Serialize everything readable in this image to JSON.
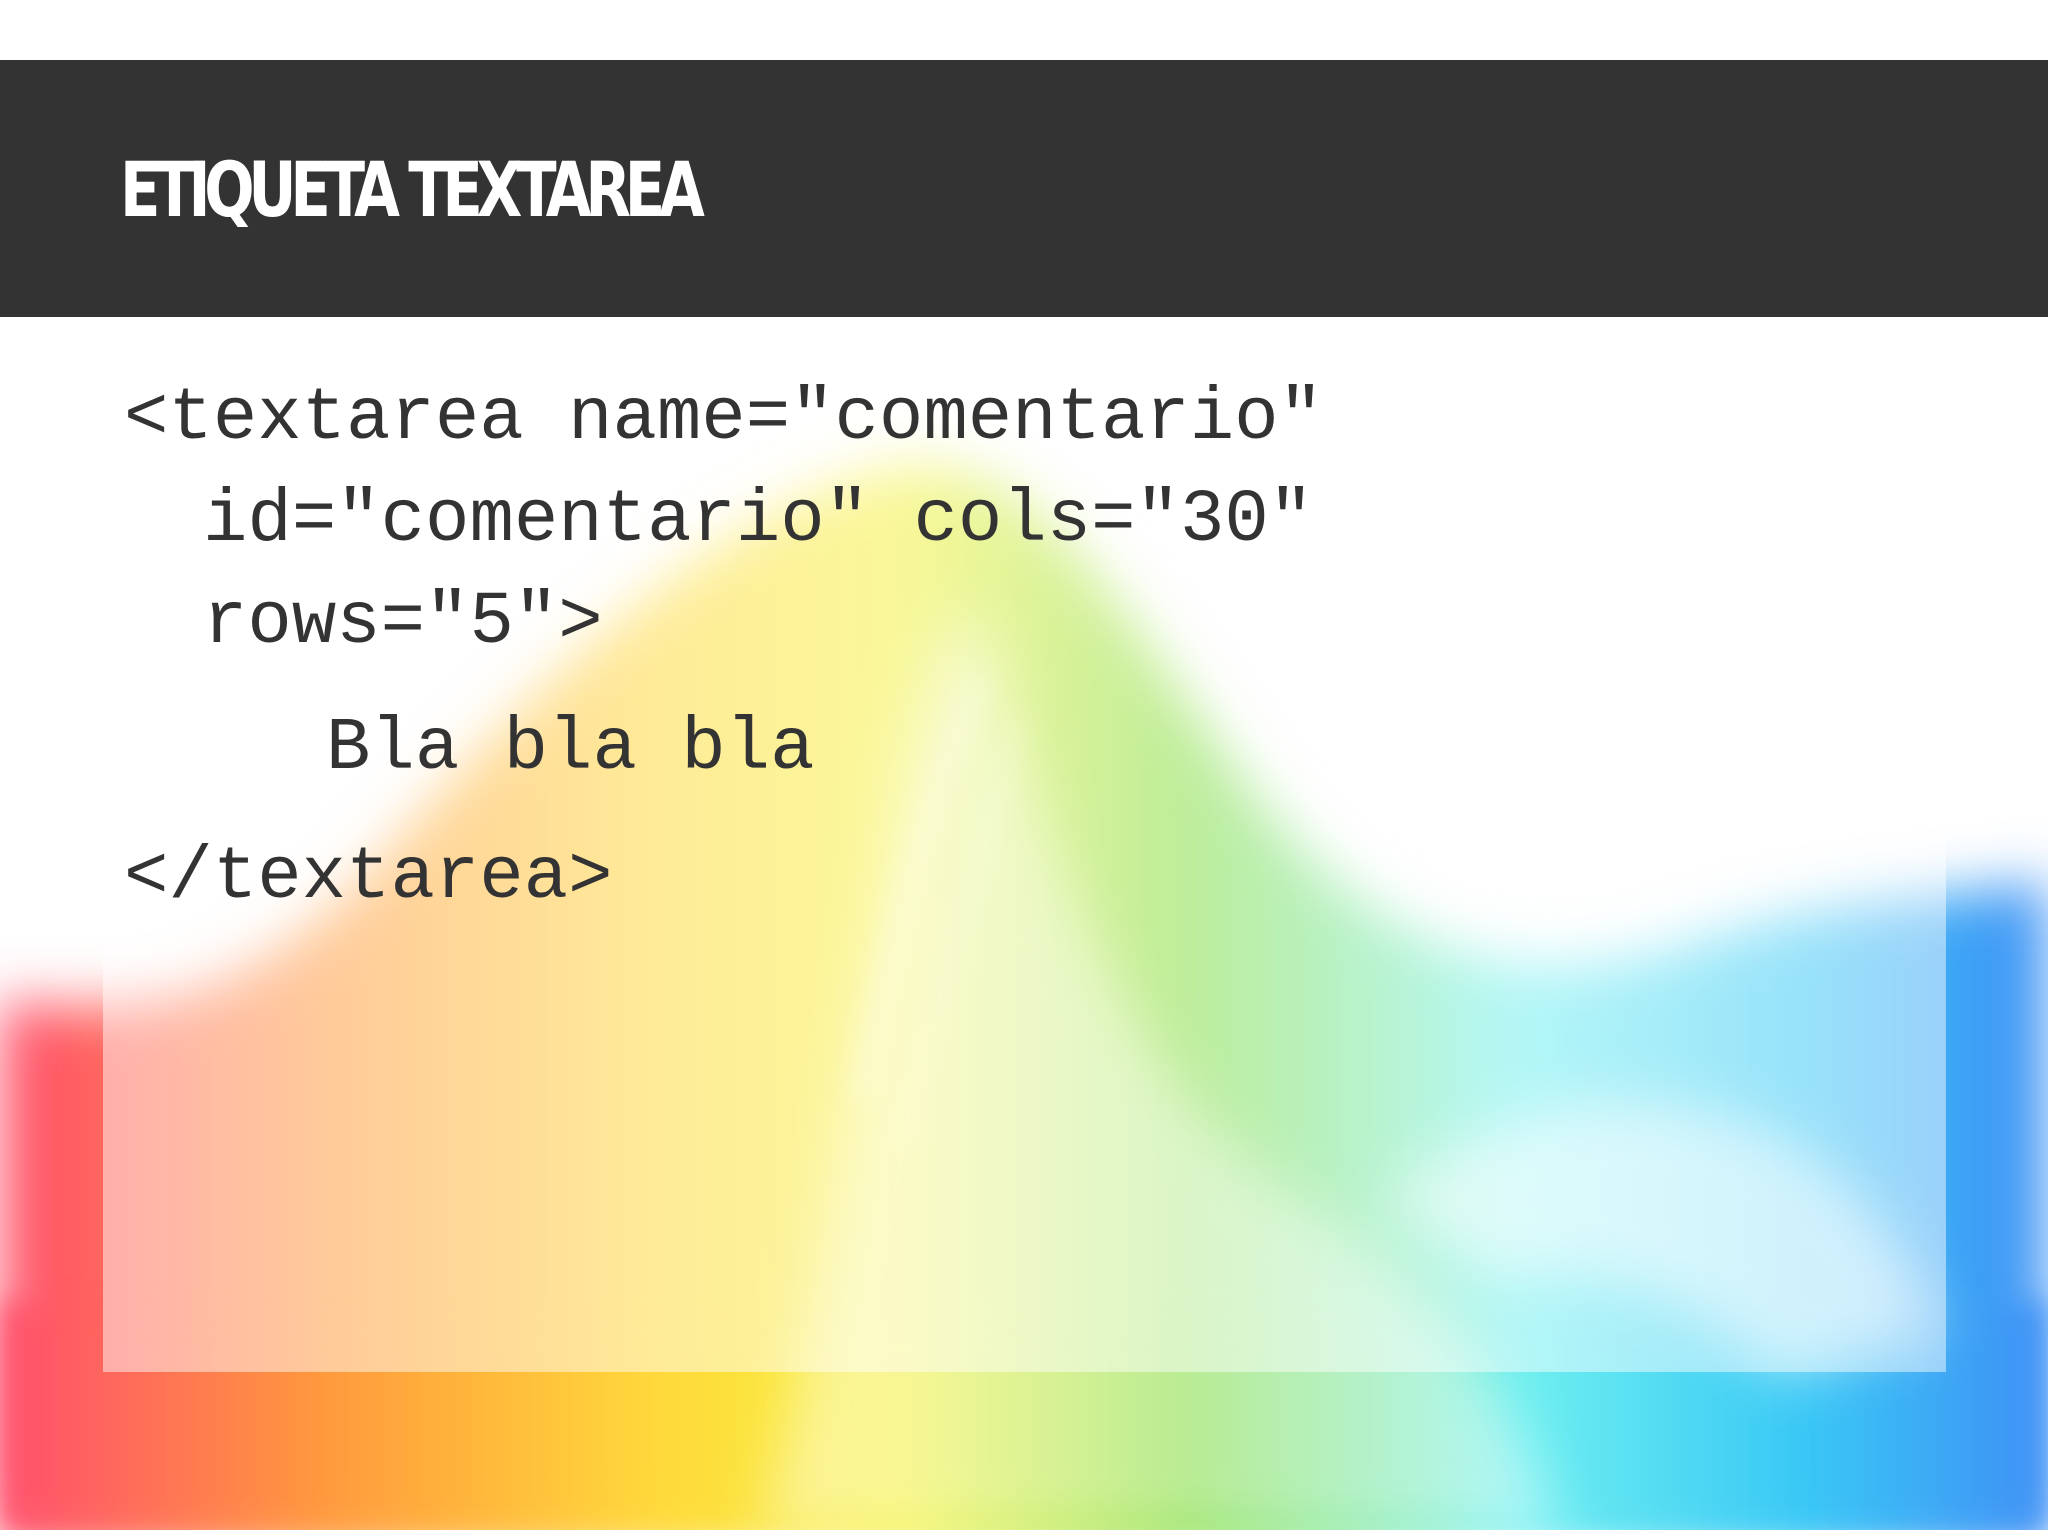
{
  "slide": {
    "title": "Etiqueta textarea",
    "code_lines": [
      "<textarea name=\"comentario\"",
      "id=\"comentario\" cols=\"30\"",
      "rows=\"5\">",
      "Bla bla bla",
      "</textarea>"
    ]
  },
  "colors": {
    "title_bar": "#333333",
    "title_text": "#ffffff",
    "code_text": "#333333",
    "background": "#ffffff"
  },
  "icons": {
    "background_art": "rainbow-wave-image"
  }
}
